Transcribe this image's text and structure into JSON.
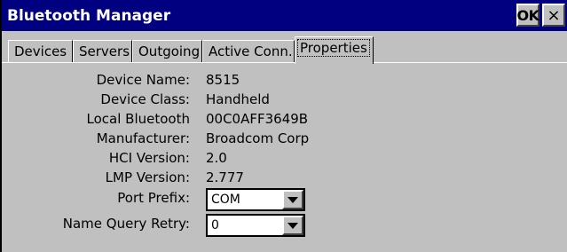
{
  "window": {
    "title": "Bluetooth Manager",
    "ok_label": "OK",
    "close_label": "×"
  },
  "tabs": [
    {
      "label": "Devices"
    },
    {
      "label": "Servers"
    },
    {
      "label": "Outgoing"
    },
    {
      "label": "Active Conn."
    },
    {
      "label": "Properties",
      "active": true
    }
  ],
  "properties": {
    "device_name": {
      "label": "Device Name:",
      "value": "8515"
    },
    "device_class": {
      "label": "Device Class:",
      "value": "Handheld"
    },
    "local_bluetooth": {
      "label": "Local Bluetooth",
      "value": "00C0AFF3649B"
    },
    "manufacturer": {
      "label": "Manufacturer:",
      "value": "Broadcom Corp"
    },
    "hci_version": {
      "label": "HCI Version:",
      "value": "2.0"
    },
    "lmp_version": {
      "label": "LMP Version:",
      "value": "2.777"
    },
    "port_prefix": {
      "label": "Port Prefix:",
      "value": "COM"
    },
    "name_query_retry": {
      "label": "Name Query Retry:",
      "value": "0"
    }
  },
  "icons": {
    "dropdown": "chevron-down-icon"
  }
}
